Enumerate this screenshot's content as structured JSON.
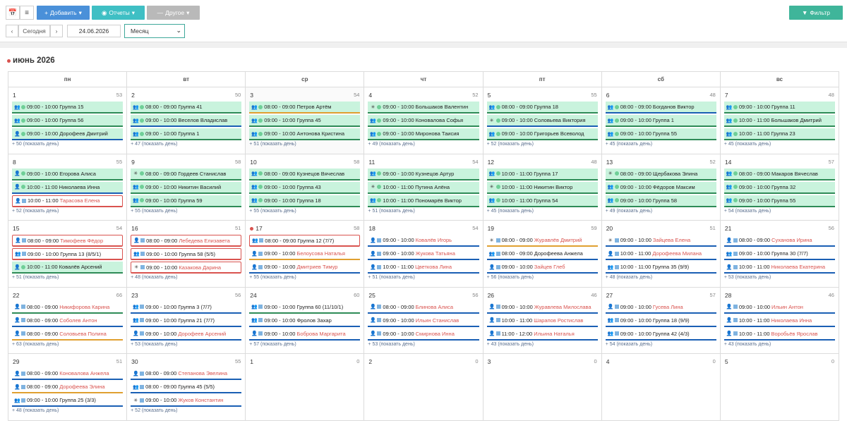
{
  "toolbar": {
    "add_label": "Добавить",
    "reports_label": "Отчеты",
    "other_label": "Другое",
    "filter_label": "Фильтр",
    "today_label": "Сегодня",
    "date_value": "24.06.2026",
    "view_value": "Месяц"
  },
  "calendar": {
    "title": "июнь 2026",
    "weekdays": [
      "пн",
      "вт",
      "ср",
      "чт",
      "пт",
      "сб",
      "вс"
    ],
    "weeks": [
      [
        {
          "n": "1",
          "c": "53",
          "ev": [
            [
              "g",
              "gr",
              "09:00 - 10:00",
              "Группа 15",
              "#2e8b57"
            ],
            [
              "g",
              "gr",
              "09:00 - 10:00",
              "Группа 56",
              "#2e8b57"
            ],
            [
              "g",
              "pr",
              "09:00 - 10:00",
              "Дорофеев Дмитрий",
              "#1a5fb4"
            ]
          ],
          "more": "+ 50 (показать день)"
        },
        {
          "n": "2",
          "c": "50",
          "ev": [
            [
              "g",
              "gr",
              "08:00 - 09:00",
              "Группа 41",
              "#2e8b57"
            ],
            [
              "g",
              "gr",
              "09:00 - 10:00",
              "Веселов Владислав",
              "#1a5fb4"
            ],
            [
              "g",
              "gr",
              "09:00 - 10:00",
              "Группа 1",
              "#2e8b57"
            ]
          ],
          "more": "+ 47 (показать день)"
        },
        {
          "n": "3",
          "c": "54",
          "today": true,
          "ev": [
            [
              "g",
              "gr",
              "08:00 - 09:00",
              "Петров Артём",
              "#e0a030"
            ],
            [
              "g",
              "gr",
              "09:00 - 10:00",
              "Группа 45",
              "#2e8b57"
            ],
            [
              "g",
              "gr",
              "09:00 - 10:00",
              "Антонова Кристина",
              "#2e8b57"
            ]
          ],
          "more": "+ 51 (показать день)"
        },
        {
          "n": "4",
          "c": "52",
          "ev": [
            [
              "g",
              "st",
              "09:00 - 10:00",
              "Большаков Валентин",
              "#2e8b57"
            ],
            [
              "g",
              "gr",
              "09:00 - 10:00",
              "Коновалова Софья",
              "#2e8b57"
            ],
            [
              "g",
              "gr",
              "09:00 - 10:00",
              "Миронова Таисия",
              "#2e8b57"
            ]
          ],
          "more": "+ 49 (показать день)"
        },
        {
          "n": "5",
          "c": "55",
          "ev": [
            [
              "g",
              "gr",
              "08:00 - 09:00",
              "Группа 18",
              "#2e8b57"
            ],
            [
              "g",
              "st",
              "09:00 - 10:00",
              "Соловьева Виктория",
              "#1a5fb4"
            ],
            [
              "g",
              "gr",
              "09:00 - 10:00",
              "Григорьев Всеволод",
              "#2e8b57"
            ]
          ],
          "more": "+ 52 (показать день)"
        },
        {
          "n": "6",
          "c": "48",
          "ev": [
            [
              "g",
              "gr",
              "08:00 - 09:00",
              "Богданов Виктор",
              "#1a5fb4"
            ],
            [
              "g",
              "gr",
              "09:00 - 10:00",
              "Группа 1",
              "#2e8b57"
            ],
            [
              "g",
              "gr",
              "09:00 - 10:00",
              "Группа 55",
              "#2e8b57"
            ]
          ],
          "more": "+ 45 (показать день)"
        },
        {
          "n": "7",
          "c": "48",
          "ev": [
            [
              "g",
              "gr",
              "09:00 - 10:00",
              "Группа 11",
              "#2e8b57"
            ],
            [
              "g",
              "gr",
              "10:00 - 11:00",
              "Большаков Дмитрий",
              "#2e8b57"
            ],
            [
              "g",
              "gr",
              "10:00 - 11:00",
              "Группа 23",
              "#2e8b57"
            ]
          ],
          "more": "+ 45 (показать день)"
        }
      ],
      [
        {
          "n": "8",
          "c": "55",
          "ev": [
            [
              "g",
              "pr",
              "09:00 - 10:00",
              "Егорова Алиса",
              "#2e8b57"
            ],
            [
              "g",
              "pr",
              "10:00 - 11:00",
              "Николаева Инна",
              "#1a5fb4"
            ],
            [
              "r",
              "pr",
              "10:00 - 11:00",
              "Тарасова Елена",
              "#d9534f"
            ]
          ],
          "more": "+ 52 (показать день)"
        },
        {
          "n": "9",
          "c": "58",
          "ev": [
            [
              "g",
              "st",
              "08:00 - 09:00",
              "Гордеев Станислав",
              "#2e8b57"
            ],
            [
              "g",
              "gr",
              "09:00 - 10:00",
              "Никитин Василий",
              "#2e8b57"
            ],
            [
              "g",
              "gr",
              "09:00 - 10:00",
              "Группа 59",
              "#2e8b57"
            ]
          ],
          "more": "+ 55 (показать день)"
        },
        {
          "n": "10",
          "c": "58",
          "ev": [
            [
              "g",
              "gr",
              "08:00 - 09:00",
              "Кузнецов Вячеслав",
              "#2e8b57"
            ],
            [
              "g",
              "gr",
              "09:00 - 10:00",
              "Группа 43",
              "#2e8b57"
            ],
            [
              "g",
              "gr",
              "09:00 - 10:00",
              "Группа 18",
              "#2e8b57"
            ]
          ],
          "more": "+ 55 (показать день)"
        },
        {
          "n": "11",
          "c": "54",
          "ev": [
            [
              "g",
              "gr",
              "09:00 - 10:00",
              "Кузнецов Артур",
              "#2e8b57"
            ],
            [
              "g",
              "st",
              "10:00 - 11:00",
              "Путина Алёна",
              "#2e8b57"
            ],
            [
              "g",
              "gr",
              "10:00 - 11:00",
              "Пономарёв Виктор",
              "#2e8b57"
            ]
          ],
          "more": "+ 51 (показать день)"
        },
        {
          "n": "12",
          "c": "48",
          "ev": [
            [
              "g",
              "gr",
              "10:00 - 11:00",
              "Группа 17",
              "#2e8b57"
            ],
            [
              "g",
              "st",
              "10:00 - 11:00",
              "Никитин Виктор",
              "#2e8b57"
            ],
            [
              "g",
              "gr",
              "10:00 - 11:00",
              "Группа 54",
              "#2e8b57"
            ]
          ],
          "more": "+ 45 (показать день)"
        },
        {
          "n": "13",
          "c": "52",
          "ev": [
            [
              "g",
              "st",
              "08:00 - 09:00",
              "Щербакова Элина",
              "#2e8b57"
            ],
            [
              "g",
              "gr",
              "09:00 - 10:00",
              "Фёдоров Максим",
              "#2e8b57"
            ],
            [
              "g",
              "gr",
              "09:00 - 10:00",
              "Группа 58",
              "#2e8b57"
            ]
          ],
          "more": "+ 49 (показать день)"
        },
        {
          "n": "14",
          "c": "57",
          "ev": [
            [
              "g",
              "gr",
              "08:00 - 09:00",
              "Макаров Вячеслав",
              "#2e8b57"
            ],
            [
              "g",
              "gr",
              "09:00 - 10:00",
              "Группа 32",
              "#2e8b57"
            ],
            [
              "g",
              "gr",
              "09:00 - 10:00",
              "Группа 55",
              "#2e8b57"
            ]
          ],
          "more": "+ 54 (показать день)"
        }
      ],
      [
        {
          "n": "15",
          "c": "54",
          "ev": [
            [
              "r",
              "pr",
              "08:00 - 09:00",
              "Тимофеев Фёдор",
              "#d9534f"
            ],
            [
              "r",
              "gr",
              "09:00 - 10:00",
              "Группа 13 (8/5/1)",
              "#d9534f"
            ],
            [
              "g",
              "pr",
              "10:00 - 11:00",
              "Ковалёв Арсений",
              "#2e8b57"
            ]
          ],
          "more": "+ 51 (показать день)"
        },
        {
          "n": "16",
          "c": "51",
          "ev": [
            [
              "r",
              "pr",
              "08:00 - 09:00",
              "Лебедева Елизавета",
              "#d9534f"
            ],
            [
              "r",
              "gr",
              "09:00 - 10:00",
              "Группа 58 (5/5)",
              "#d9534f"
            ],
            [
              "r",
              "st",
              "09:00 - 10:00",
              "Казакова Дарина",
              "#d9534f"
            ]
          ],
          "more": "+ 48 (показать день)"
        },
        {
          "n": "17",
          "c": "58",
          "dot": true,
          "ev": [
            [
              "r",
              "gr",
              "08:00 - 09:00",
              "Группа 12 (7/7)",
              "#d9534f"
            ],
            [
              "w",
              "pr",
              "09:00 - 10:00",
              "Белоусова Наталья",
              "#e0a030"
            ],
            [
              "w",
              "pr",
              "09:00 - 10:00",
              "Дмитриев Тимур",
              "#1a5fb4"
            ]
          ],
          "more": "+ 55 (показать день)"
        },
        {
          "n": "18",
          "c": "54",
          "ev": [
            [
              "w",
              "pr",
              "09:00 - 10:00",
              "Ковалёв Игорь",
              "#1a5fb4"
            ],
            [
              "w",
              "pr",
              "09:00 - 10:00",
              "Жукова Татьяна",
              "#1a5fb4"
            ],
            [
              "w",
              "pr",
              "10:00 - 11:00",
              "Цветкова Лина",
              "#1a5fb4"
            ]
          ],
          "more": "+ 51 (показать день)"
        },
        {
          "n": "19",
          "c": "59",
          "ev": [
            [
              "w",
              "st",
              "08:00 - 09:00",
              "Журавлёв Дмитрий",
              "#e0a030"
            ],
            [
              "w",
              "gr",
              "08:00 - 09:00",
              "Дорофеева Анжела",
              "#1a5fb4"
            ],
            [
              "w",
              "pr",
              "09:00 - 10:00",
              "Зайцев Глеб",
              "#1a5fb4"
            ]
          ],
          "more": "+ 56 (показать день)"
        },
        {
          "n": "20",
          "c": "51",
          "ev": [
            [
              "w",
              "st",
              "09:00 - 10:00",
              "Зайцева Елена",
              "#1a5fb4"
            ],
            [
              "w",
              "pr",
              "10:00 - 11:00",
              "Дорофеева Милана",
              "#1a5fb4"
            ],
            [
              "w",
              "gr",
              "10:00 - 11:00",
              "Группа 35 (9/9)",
              "#1a5fb4"
            ]
          ],
          "more": "+ 48 (показать день)"
        },
        {
          "n": "21",
          "c": "56",
          "ev": [
            [
              "w",
              "pr",
              "08:00 - 09:00",
              "Суханова Ирина",
              "#1a5fb4"
            ],
            [
              "w",
              "gr",
              "09:00 - 10:00",
              "Группа 30 (7/7)",
              "#1a5fb4"
            ],
            [
              "w",
              "pr",
              "10:00 - 11:00",
              "Николаева Екатерина",
              "#1a5fb4"
            ]
          ],
          "more": "+ 53 (показать день)"
        }
      ],
      [
        {
          "n": "22",
          "c": "66",
          "ev": [
            [
              "w",
              "pr",
              "08:00 - 09:00",
              "Никифорова Карина",
              "#2e8b57"
            ],
            [
              "w",
              "pr",
              "08:00 - 09:00",
              "Соболев Антон",
              "#1a5fb4"
            ],
            [
              "w",
              "pr",
              "08:00 - 09:00",
              "Соловьева Полина",
              "#e0a030"
            ]
          ],
          "more": "+ 63 (показать день)"
        },
        {
          "n": "23",
          "c": "56",
          "ev": [
            [
              "w",
              "gr",
              "09:00 - 10:00",
              "Группа 3 (7/7)",
              "#1a5fb4"
            ],
            [
              "w",
              "gr",
              "09:00 - 10:00",
              "Группа 21 (7/7)",
              "#1a5fb4"
            ],
            [
              "w",
              "pr",
              "09:00 - 10:00",
              "Дорофеев Арсений",
              "#1a5fb4"
            ]
          ],
          "more": "+ 53 (показать день)"
        },
        {
          "n": "24",
          "c": "60",
          "ev": [
            [
              "w",
              "gr",
              "09:00 - 10:00",
              "Группа 60 (11/10/1)",
              "#2e8b57"
            ],
            [
              "w",
              "gr",
              "09:00 - 10:00",
              "Фролов Захар",
              "#1a5fb4"
            ],
            [
              "w",
              "pr",
              "09:00 - 10:00",
              "Боброва Маргарита",
              "#1a5fb4"
            ]
          ],
          "more": "+ 57 (показать день)"
        },
        {
          "n": "25",
          "c": "56",
          "ev": [
            [
              "w",
              "pr",
              "08:00 - 09:00",
              "Блинова Алиса",
              "#1a5fb4"
            ],
            [
              "w",
              "pr",
              "09:00 - 10:00",
              "Ильин Станислав",
              "#1a5fb4"
            ],
            [
              "w",
              "pr",
              "09:00 - 10:00",
              "Смирнова Инна",
              "#1a5fb4"
            ]
          ],
          "more": "+ 53 (показать день)"
        },
        {
          "n": "26",
          "c": "46",
          "ev": [
            [
              "w",
              "pr",
              "09:00 - 10:00",
              "Журавлева Милослава",
              "#1a5fb4"
            ],
            [
              "w",
              "pr",
              "10:00 - 11:00",
              "Шарапов Ростислав",
              "#1a5fb4"
            ],
            [
              "w",
              "pr",
              "11:00 - 12:00",
              "Ильина Наталья",
              "#1a5fb4"
            ]
          ],
          "more": "+ 43 (показать день)"
        },
        {
          "n": "27",
          "c": "57",
          "ev": [
            [
              "w",
              "pr",
              "09:00 - 10:00",
              "Гусева Лина",
              "#1a5fb4"
            ],
            [
              "w",
              "gr",
              "09:00 - 10:00",
              "Группа 18 (9/9)",
              "#1a5fb4"
            ],
            [
              "w",
              "gr",
              "09:00 - 10:00",
              "Группа 42 (4/3)",
              "#1a5fb4"
            ]
          ],
          "more": "+ 54 (показать день)"
        },
        {
          "n": "28",
          "c": "46",
          "ev": [
            [
              "w",
              "pr",
              "09:00 - 10:00",
              "Ильин Антон",
              "#1a5fb4"
            ],
            [
              "w",
              "pr",
              "10:00 - 11:00",
              "Николаева Инна",
              "#1a5fb4"
            ],
            [
              "w",
              "pr",
              "10:00 - 11:00",
              "Воробьёв Ярослав",
              "#1a5fb4"
            ]
          ],
          "more": "+ 43 (показать день)"
        }
      ],
      [
        {
          "n": "29",
          "c": "51",
          "ev": [
            [
              "w",
              "pr",
              "08:00 - 09:00",
              "Коновалова Анжела",
              "#1a5fb4"
            ],
            [
              "w",
              "pr",
              "08:00 - 09:00",
              "Дорофеева Элина",
              "#e0a030"
            ],
            [
              "w",
              "gr",
              "09:00 - 10:00",
              "Группа 25 (3/3)",
              "#1a5fb4"
            ]
          ],
          "more": "+ 48 (показать день)"
        },
        {
          "n": "30",
          "c": "55",
          "ev": [
            [
              "w",
              "pr",
              "08:00 - 09:00",
              "Степанова Эвелина",
              "#1a5fb4"
            ],
            [
              "w",
              "gr",
              "08:00 - 09:00",
              "Группа 45 (5/5)",
              "#1a5fb4"
            ],
            [
              "w",
              "st",
              "09:00 - 10:00",
              "Жуков Константин",
              "#1a5fb4"
            ]
          ],
          "more": "+ 52 (показать день)"
        },
        {
          "n": "1",
          "c": "0",
          "ev": [],
          "more": ""
        },
        {
          "n": "2",
          "c": "0",
          "ev": [],
          "more": ""
        },
        {
          "n": "3",
          "c": "0",
          "ev": [],
          "more": ""
        },
        {
          "n": "4",
          "c": "0",
          "ev": [],
          "more": ""
        },
        {
          "n": "5",
          "c": "0",
          "ev": [],
          "more": ""
        }
      ]
    ]
  }
}
